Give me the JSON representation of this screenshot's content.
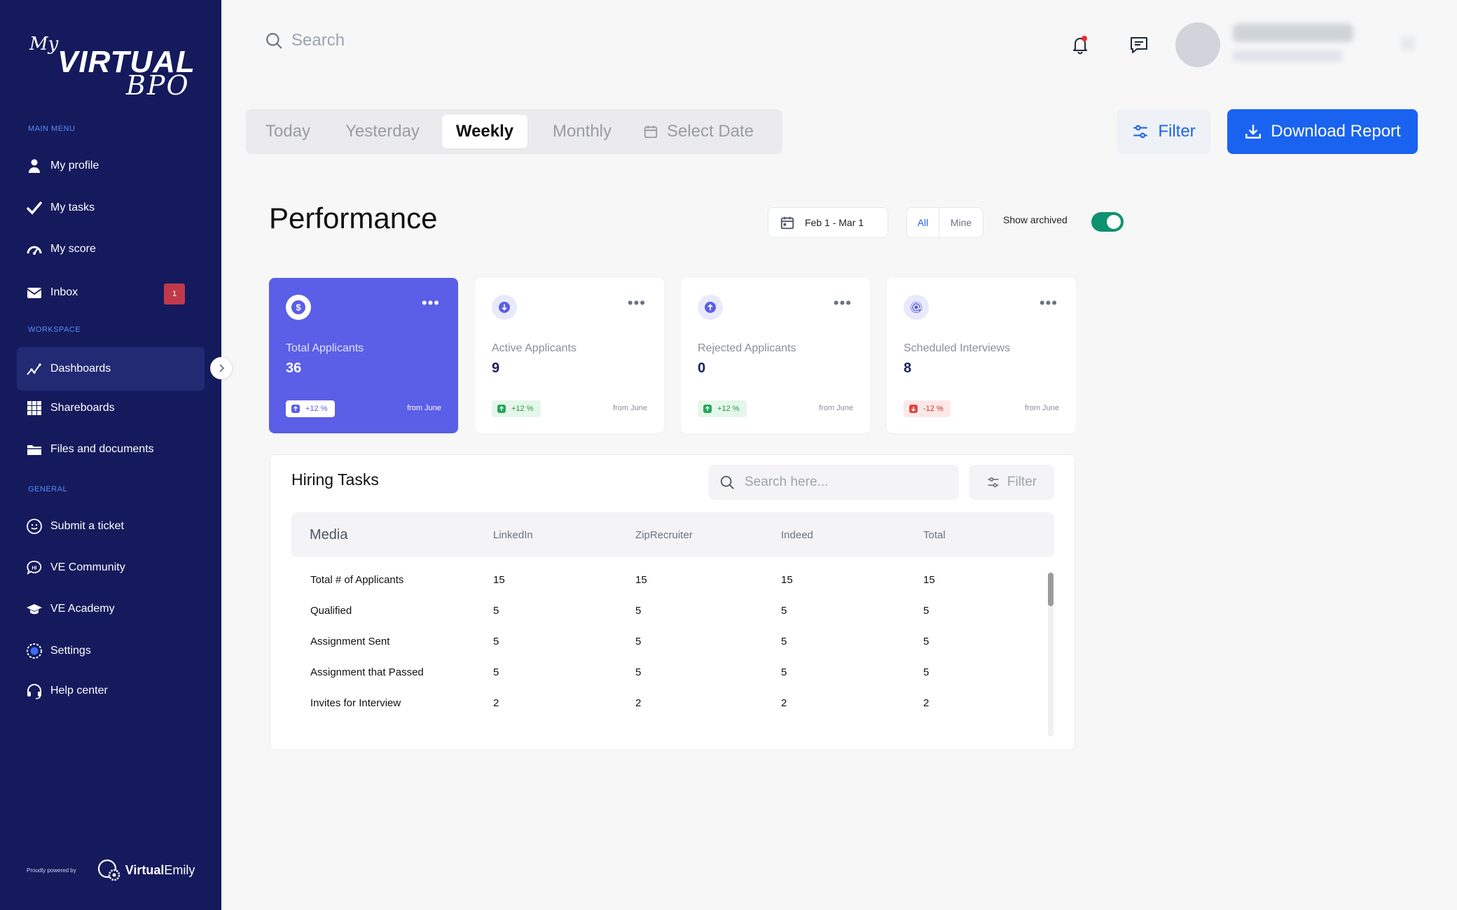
{
  "brand": {
    "my": "My",
    "virtual": "VIRTUAL",
    "bpo": "BPO"
  },
  "sidebar": {
    "main_menu_label": "MAIN MENU",
    "workspace_label": "WORKSPACE",
    "general_label": "GENERAL",
    "main": [
      {
        "label": "My profile",
        "icon": "user-icon"
      },
      {
        "label": "My tasks",
        "icon": "check-icon"
      },
      {
        "label": "My score",
        "icon": "gauge-icon"
      },
      {
        "label": "Inbox",
        "icon": "mail-icon",
        "badge": "1"
      }
    ],
    "workspace": [
      {
        "label": "Dashboards",
        "icon": "chart-line-icon",
        "active": true
      },
      {
        "label": "Shareboards",
        "icon": "grid-icon"
      },
      {
        "label": "Files and documents",
        "icon": "folder-icon"
      }
    ],
    "general": [
      {
        "label": "Submit a ticket",
        "icon": "smile-icon"
      },
      {
        "label": "VE Community",
        "icon": "chat-hi-icon"
      },
      {
        "label": "VE Academy",
        "icon": "graduation-cap-icon"
      },
      {
        "label": "Settings",
        "icon": "gear-icon"
      },
      {
        "label": "Help center",
        "icon": "headset-icon"
      }
    ],
    "powered_by": "Proudly powered by",
    "powered_brand_bold": "Virtual",
    "powered_brand_rest": " Emily"
  },
  "topbar": {
    "search_placeholder": "Search"
  },
  "range_tabs": {
    "today": "Today",
    "yesterday": "Yesterday",
    "weekly": "Weekly",
    "monthly": "Monthly",
    "select_date": "Select Date",
    "active": "Weekly"
  },
  "actions": {
    "filter": "Filter",
    "download": "Download Report"
  },
  "performance": {
    "title": "Performance",
    "date_range": "Feb 1 - Mar 1",
    "scope_all": "All",
    "scope_mine": "Mine",
    "show_archived": "Show archived",
    "archived_on": true
  },
  "cards": [
    {
      "label": "Total Applicants",
      "value": "36",
      "change": "+12 %",
      "direction": "up",
      "from": "from June",
      "icon": "dollar-icon"
    },
    {
      "label": "Active Applicants",
      "value": "9",
      "change": "+12 %",
      "direction": "up",
      "from": "from June",
      "icon": "arrow-down-icon"
    },
    {
      "label": "Rejected Applicants",
      "value": "0",
      "change": "+12 %",
      "direction": "up",
      "from": "from June",
      "icon": "arrow-up-icon"
    },
    {
      "label": "Scheduled Interviews",
      "value": "8",
      "change": "-12 %",
      "direction": "down",
      "from": "from June",
      "icon": "at-icon"
    }
  ],
  "hiring_tasks": {
    "title": "Hiring Tasks",
    "search_placeholder": "Search here...",
    "filter": "Filter",
    "columns": [
      "Media",
      "LinkedIn",
      "ZipRecruiter",
      "Indeed",
      "Total"
    ],
    "rows": [
      [
        "Total # of Applicants",
        "15",
        "15",
        "15",
        "15"
      ],
      [
        "Qualified",
        "5",
        "5",
        "5",
        "5"
      ],
      [
        "Assignment Sent",
        "5",
        "5",
        "5",
        "5"
      ],
      [
        "Assignment that Passed",
        "5",
        "5",
        "5",
        "5"
      ],
      [
        "Invites for Interview",
        "2",
        "2",
        "2",
        "2"
      ]
    ]
  },
  "colors": {
    "sidebar_bg": "#141a5c",
    "primary": "#1a63f0",
    "card_primary": "#5b5ee6",
    "toggle_on": "#0e9270",
    "badge": "#c0394b"
  }
}
